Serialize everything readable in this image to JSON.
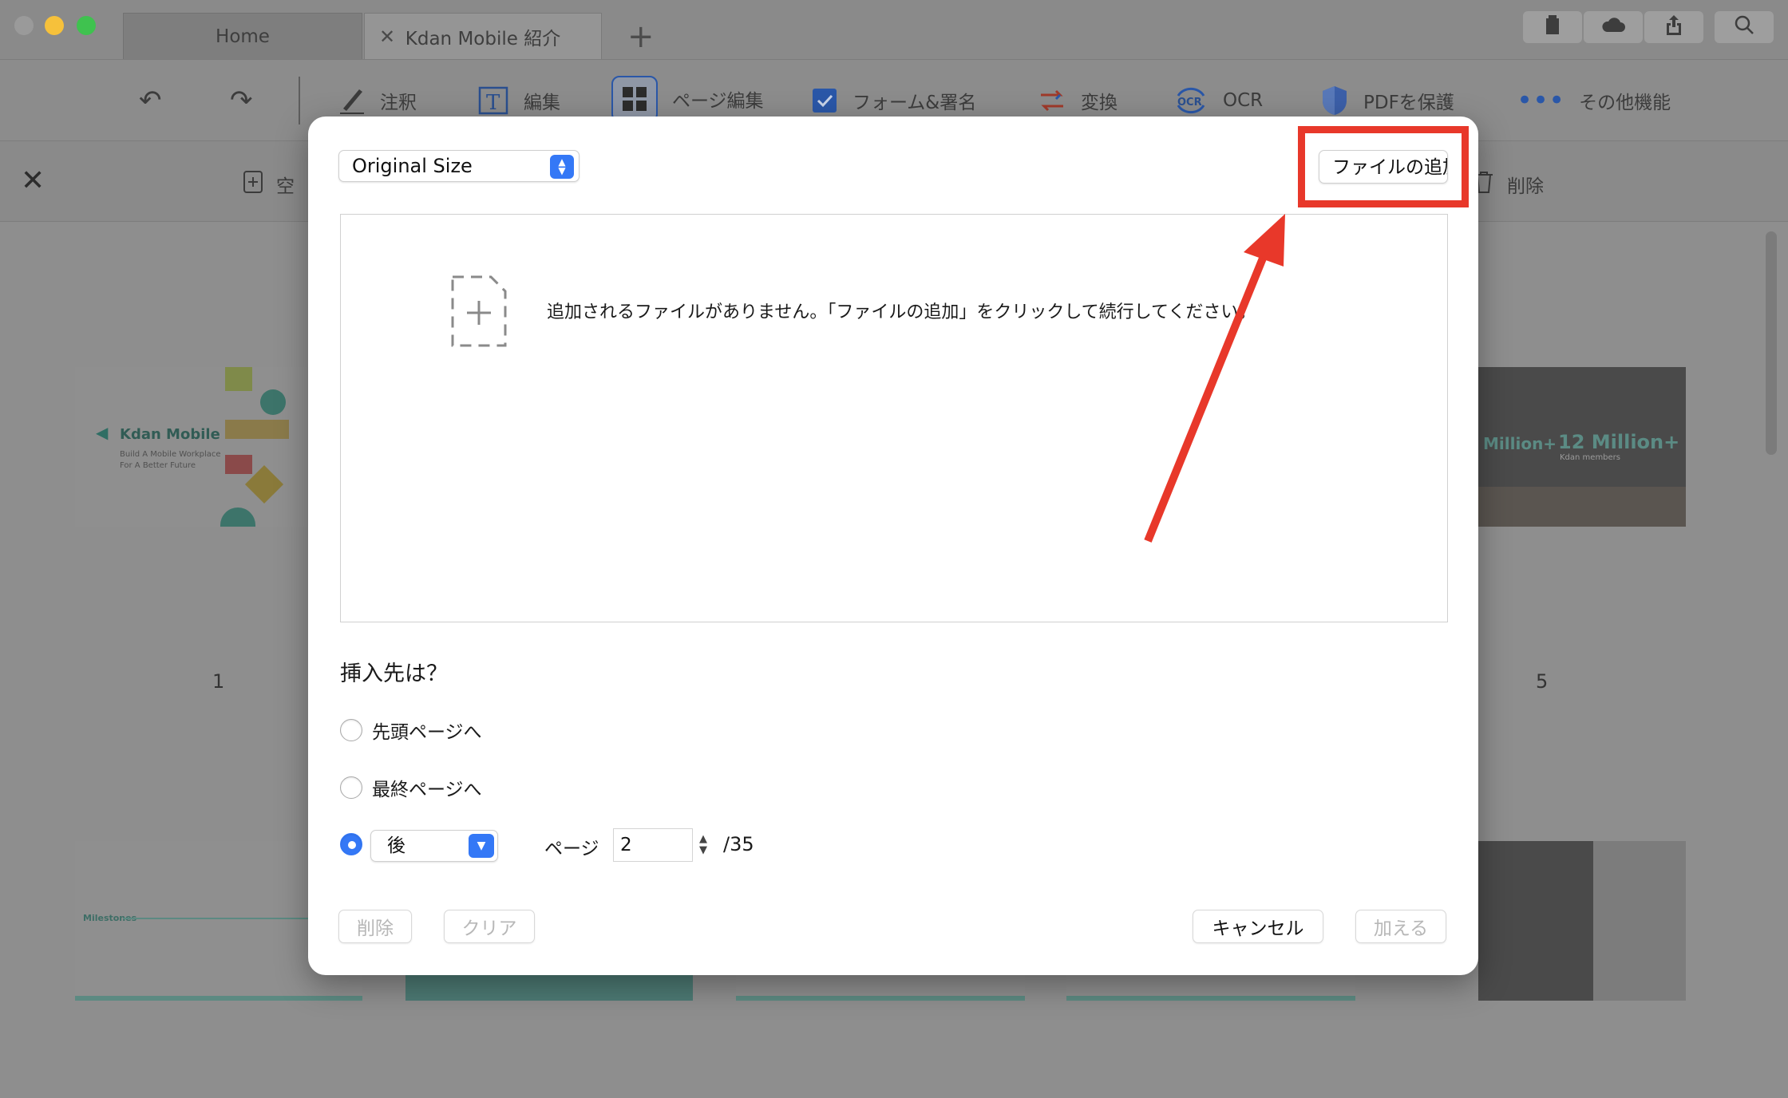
{
  "window": {
    "tabs": [
      {
        "label": "Home",
        "closable": false
      },
      {
        "label": "Kdan Mobile 紹介",
        "closable": true
      }
    ],
    "add_tab_label": "+"
  },
  "toolbar": {
    "undo_label": "↶",
    "redo_label": "↷",
    "tools": [
      {
        "label": "注釈",
        "icon": "pen-icon"
      },
      {
        "label": "編集",
        "icon": "text-edit-icon"
      },
      {
        "label": "ページ編集",
        "icon": "page-grid-icon"
      },
      {
        "label": "フォーム&署名",
        "icon": "checkbox-icon"
      },
      {
        "label": "変換",
        "icon": "convert-icon"
      },
      {
        "label": "OCR",
        "icon": "ocr-icon"
      },
      {
        "label": "PDFを保護",
        "icon": "shield-icon"
      },
      {
        "label": "その他機能",
        "icon": "more-icon"
      }
    ]
  },
  "subbar": {
    "blank_label": "空",
    "delete_label": "削除"
  },
  "pages": {
    "numbers": [
      "1",
      "5"
    ],
    "thumb1_title": "Kdan Mobile",
    "thumb1_sub1": "Build A Mobile Workplace",
    "thumb1_sub2": "For A Better Future",
    "thumb5_stat1": "Million+",
    "thumb5_stat2": "12 Million+",
    "thumb5_caption": "Kdan members",
    "milestones_label": "Milestones"
  },
  "dialog": {
    "size_select_value": "Original Size",
    "add_file_button": "ファイルの追加",
    "empty_message": "追加されるファイルがありません。「ファイルの追加」をクリックして続行してください。",
    "insert_title": "挿入先は？",
    "options": {
      "first": "先頭ページへ",
      "last": "最終ページへ",
      "after_select": "後"
    },
    "selected_option": "after",
    "page_label": "ページ",
    "page_value": "2",
    "page_total": "/35",
    "buttons": {
      "delete": "削除",
      "clear": "クリア",
      "cancel": "キャンセル",
      "add": "加える"
    }
  },
  "colors": {
    "accent": "#3478f6",
    "highlight_red": "#e8382a"
  }
}
